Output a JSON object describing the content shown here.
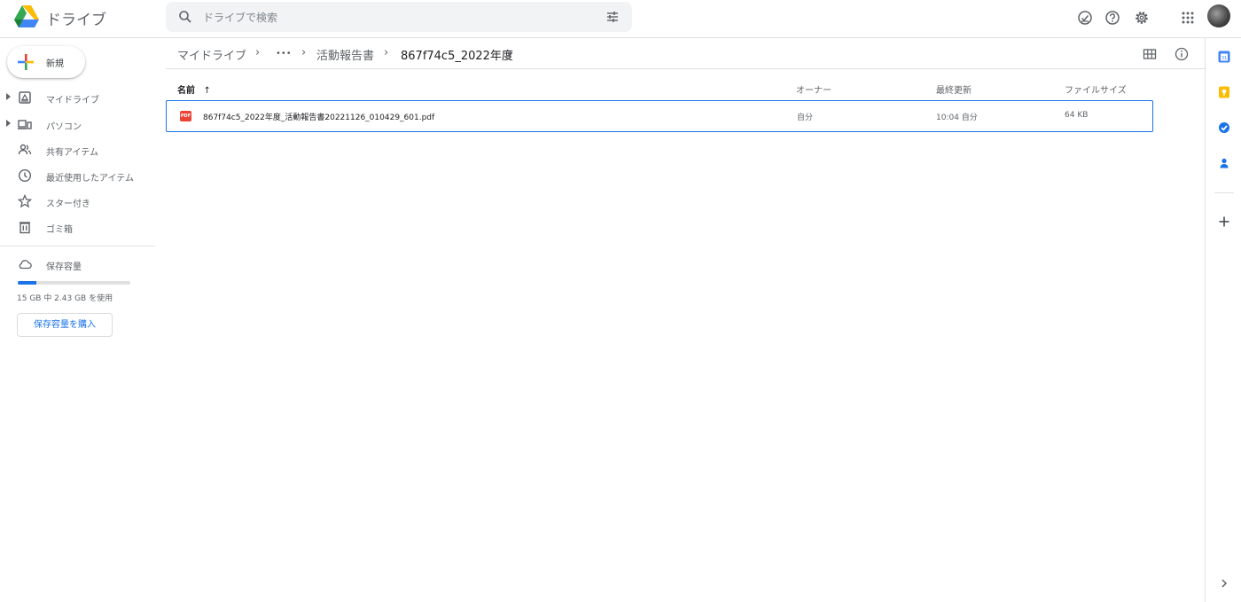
{
  "header": {
    "app_title": "ドライブ",
    "search_placeholder": "ドライブで検索",
    "icons": [
      "offline-check-icon",
      "help-icon",
      "settings-icon",
      "apps-grid-icon"
    ]
  },
  "sidebar": {
    "new_label": "新規",
    "items": [
      {
        "label": "マイドライブ",
        "icon": "my-drive-icon",
        "expandable": true
      },
      {
        "label": "パソコン",
        "icon": "computers-icon",
        "expandable": true
      },
      {
        "label": "共有アイテム",
        "icon": "shared-icon",
        "expandable": false
      },
      {
        "label": "最近使用したアイテム",
        "icon": "recent-icon",
        "expandable": false
      },
      {
        "label": "スター付き",
        "icon": "star-icon",
        "expandable": false
      },
      {
        "label": "ゴミ箱",
        "icon": "trash-icon",
        "expandable": false
      }
    ],
    "storage": {
      "label": "保存容量",
      "usage_text": "15 GB 中 2.43 GB を使用",
      "used_fraction": 0.162,
      "buy_label": "保存容量を購入"
    }
  },
  "breadcrumb": {
    "root": "マイドライブ",
    "ellipsis": "•••",
    "parent": "活動報告書",
    "current": "867f74c5_2022年度"
  },
  "table": {
    "headers": {
      "name": "名前",
      "owner": "オーナー",
      "modified": "最終更新",
      "size": "ファイルサイズ"
    },
    "rows": [
      {
        "name": "867f74c5_2022年度_活動報告書20221126_010429_601.pdf",
        "owner": "自分",
        "modified": "10:04 自分",
        "size": "64 KB",
        "file_icon": "PDF"
      }
    ]
  },
  "colors": {
    "accent": "#1a73e8",
    "pdf": "#ea4335"
  }
}
